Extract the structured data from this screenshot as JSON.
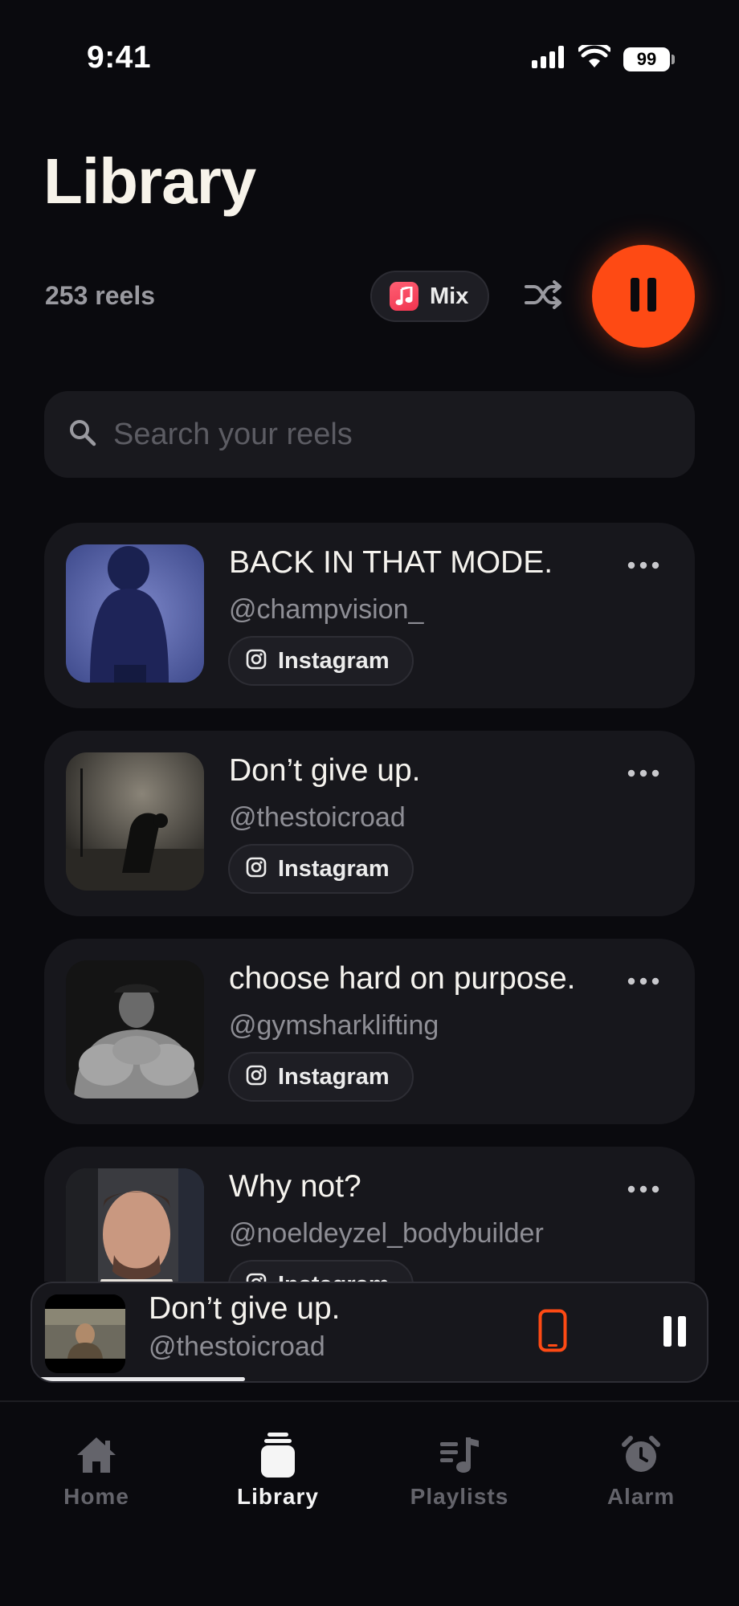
{
  "status_bar": {
    "time": "9:41",
    "battery": "99"
  },
  "header": {
    "title": "Library",
    "reel_count": "253 reels",
    "mix_label": "Mix"
  },
  "search": {
    "placeholder": "Search your reels"
  },
  "reels": [
    {
      "title": "BACK IN THAT MODE.",
      "handle": "@champvision_",
      "source": "Instagram"
    },
    {
      "title": "Don’t give up.",
      "handle": "@thestoicroad",
      "source": "Instagram"
    },
    {
      "title": "choose hard on purpose.",
      "handle": "@gymsharklifting",
      "source": "Instagram"
    },
    {
      "title": "Why not?",
      "handle": "@noeldeyzel_bodybuilder",
      "source": "Instagram"
    }
  ],
  "now_playing": {
    "title": "Don’t give up.",
    "handle": "@thestoicroad",
    "progress": 0.31
  },
  "tabs": [
    {
      "label": "Home",
      "icon": "home-icon"
    },
    {
      "label": "Library",
      "icon": "library-icon",
      "active": true
    },
    {
      "label": "Playlists",
      "icon": "playlists-icon"
    },
    {
      "label": "Alarm",
      "icon": "alarm-icon"
    }
  ],
  "colors": {
    "background": "#0a0a0e",
    "accent": "#fe4a14",
    "card": "#17171c",
    "muted_text": "#8e8e95"
  }
}
